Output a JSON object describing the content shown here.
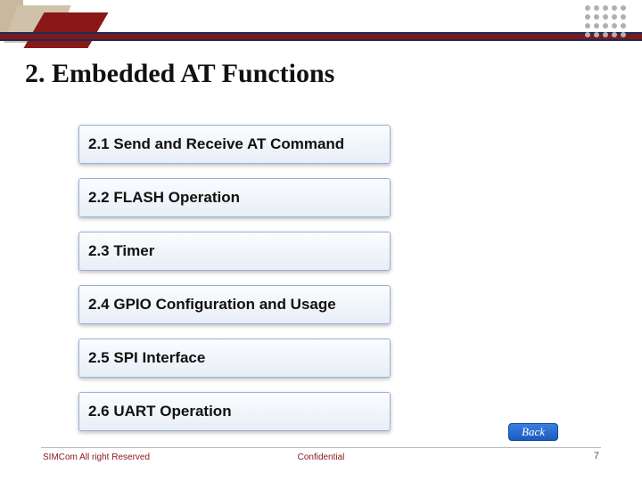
{
  "title": "2. Embedded AT Functions",
  "menu": [
    "2.1 Send and Receive AT Command",
    "2.2 FLASH Operation",
    "2.3 Timer",
    "2.4 GPIO Configuration and Usage",
    "2.5 SPI Interface",
    "2.6 UART Operation"
  ],
  "back_label": "Back",
  "footer": {
    "left": "SIMCom All right Reserved",
    "center": "Confidential",
    "page": "7"
  }
}
